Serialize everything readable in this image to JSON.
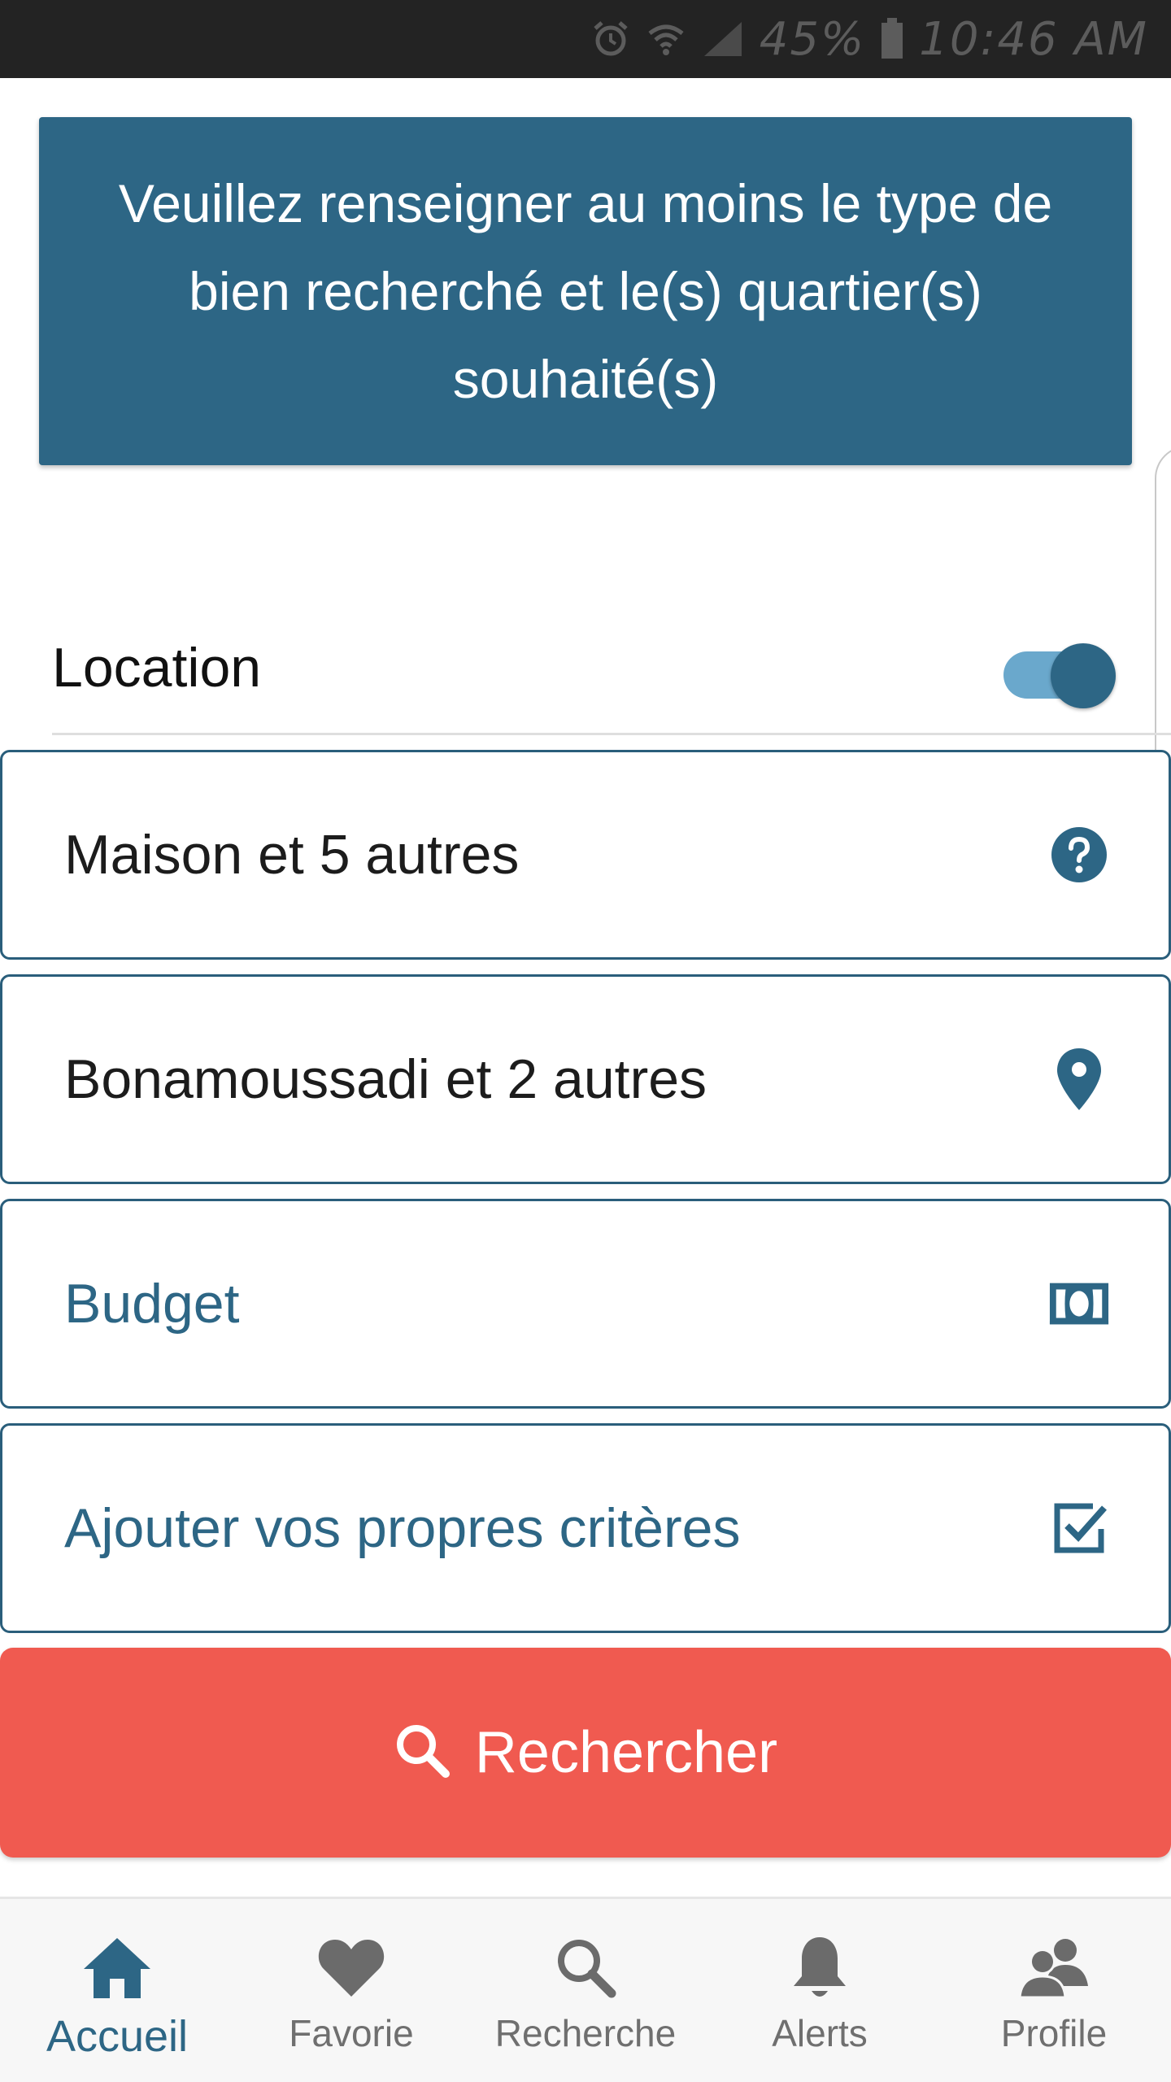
{
  "status_bar": {
    "battery": "45%",
    "time": "10:46 AM",
    "icons": [
      "alarm-icon",
      "wifi-icon",
      "signal-icon",
      "battery-icon"
    ]
  },
  "banner": {
    "message": "Veuillez renseigner au moins le type de bien recherché et le(s) quartier(s) souhaité(s)"
  },
  "filters": {
    "location_label": "Location",
    "location_enabled": true,
    "property_type": {
      "value": "Maison et 5 autres",
      "icon": "question-circle-icon"
    },
    "neighborhood": {
      "value": "Bonamoussadi et 2 autres",
      "icon": "map-pin-icon"
    },
    "budget": {
      "value": "Budget",
      "icon": "money-bill-icon"
    },
    "criteria": {
      "value": "Ajouter vos propres critères",
      "icon": "checkbox-checked-icon"
    }
  },
  "search_button": {
    "label": "Rechercher",
    "icon": "search-icon"
  },
  "bottom_nav": {
    "items": [
      {
        "label": "Accueil",
        "icon": "home-icon",
        "active": true
      },
      {
        "label": "Favorie",
        "icon": "heart-icon",
        "active": false
      },
      {
        "label": "Recherche",
        "icon": "search-icon",
        "active": false
      },
      {
        "label": "Alerts",
        "icon": "bell-icon",
        "active": false
      },
      {
        "label": "Profile",
        "icon": "users-icon",
        "active": false
      }
    ]
  },
  "colors": {
    "primary": "#2d6685",
    "toggle_track": "#6aa8cc",
    "search_button": "#f05a50",
    "status_bar": "#232323"
  }
}
